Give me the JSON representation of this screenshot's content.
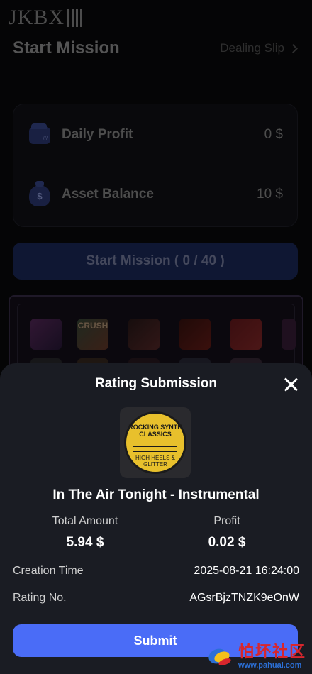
{
  "header": {
    "logo": "JKBX",
    "title": "Start Mission",
    "dealing_link": "Dealing Slip"
  },
  "stats": {
    "daily_profit_label": "Daily Profit",
    "daily_profit_value": "0 $",
    "asset_balance_label": "Asset Balance",
    "asset_balance_value": "10 $"
  },
  "start_button": "Start Mission ( 0 / 40 )",
  "gallery": {
    "thumb_label": "CRUSH"
  },
  "modal": {
    "title": "Rating Submission",
    "album": {
      "line1": "ROCKING SYNTH CLASSICS",
      "line2": "HIGH HEELS & GLITTER"
    },
    "song_title": "In The Air Tonight - Instrumental",
    "total_amount_label": "Total Amount",
    "total_amount_value": "5.94 $",
    "profit_label": "Profit",
    "profit_value": "0.02 $",
    "creation_time_label": "Creation Time",
    "creation_time_value": "2025-08-21 16:24:00",
    "rating_no_label": "Rating No.",
    "rating_no_value": "AGsrBjzTNZK9eOnW",
    "submit_label": "Submit"
  },
  "watermark": {
    "title": "怕坏社区",
    "url": "www.pahuai.com"
  },
  "colors": {
    "accent": "#4a6cf7",
    "sheet_bg": "#1a1c23",
    "page_bg": "#0a0a0c"
  }
}
